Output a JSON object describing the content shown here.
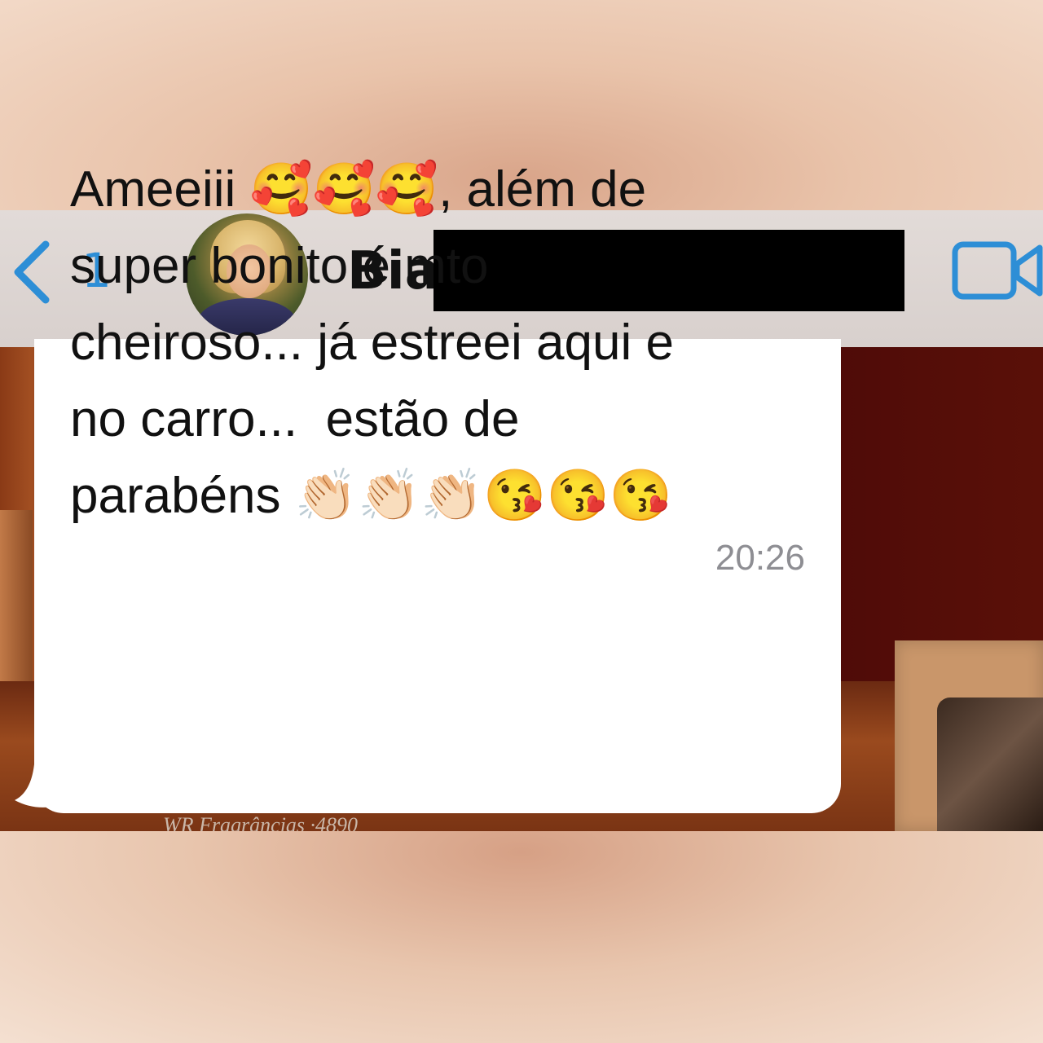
{
  "header": {
    "back_count": "1",
    "contact_name": "Bia",
    "icons": [
      "back-chevron-icon",
      "video-call-icon"
    ],
    "accent_color": "#2d8ed6"
  },
  "message": {
    "text": "Ameeiii 🥰🥰🥰, além de\nsuper bonito é mto\ncheiroso... já estreei aqui e\nno carro...  estão de\nparabéns 👏🏻👏🏻👏🏻😘😘😘",
    "time": "20:26"
  },
  "background": {
    "watermark": "WR Fragrâncias  ·4890"
  }
}
